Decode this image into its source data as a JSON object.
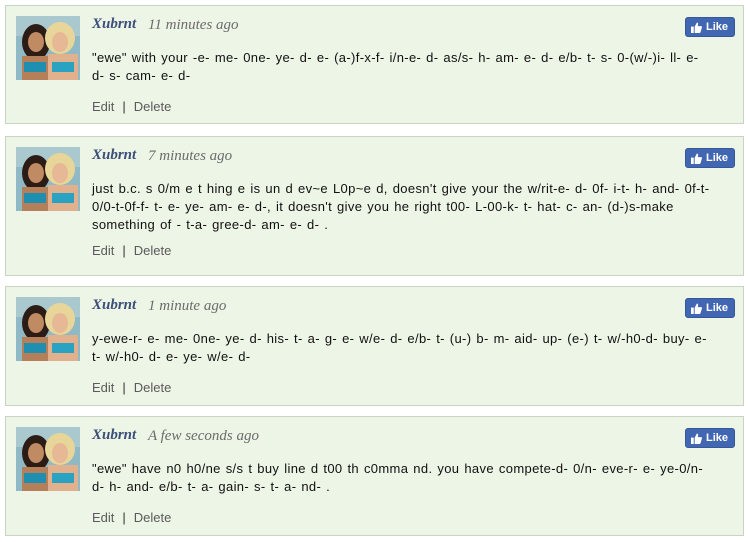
{
  "like_label": "Like",
  "edit_label": "Edit",
  "delete_label": "Delete",
  "separator": "|",
  "colors": {
    "card_bg": "#edf5e6",
    "card_border": "#c9d3c1",
    "author": "#3b4f7a",
    "like_button": "#4267b2"
  },
  "icons": {
    "avatar": "user-avatar-photo",
    "like": "thumbs-up-icon"
  },
  "comments": [
    {
      "author": "Xubrnt",
      "time": "11 minutes ago",
      "text": "\"ewe\" with your -e- me- 0ne- ye- d- e- (a-)f-x-f- i/n-e- d- as/s- h- am- e- d- e/b- t- s- 0-(w/-)i- ll- e- d- s- cam- e- d-"
    },
    {
      "author": "Xubrnt",
      "time": "7 minutes ago",
      "text": "just b.c. s 0/m e t hing e is un d ev~e L0p~e d, doesn't give your the w/rit-e- d- 0f- i-t- h- and- 0f-t- 0/0-t-0f-f- t- e- ye- am- e- d-, it doesn't give you he right t00- L-00-k- t- hat- c- an- (d-)s-make something of - t-a- gree-d- am- e- d- ."
    },
    {
      "author": "Xubrnt",
      "time": "1 minute ago",
      "text": "y-ewe-r- e- me- 0ne- ye- d- his- t- a- g- e- w/e- d- e/b- t- (u-) b- m- aid- up- (e-) t- w/-h0-d- buy- e- t- w/-h0- d- e- ye- w/e- d-"
    },
    {
      "author": "Xubrnt",
      "time": "A few seconds ago",
      "text": "\"ewe\" have n0 h0/ne s/s t buy line d t00 th c0mma nd. you have compete-d- 0/n- eve-r- e- ye-0/n- d- h- and- e/b- t- a- gain- s- t- a- nd- ."
    }
  ]
}
